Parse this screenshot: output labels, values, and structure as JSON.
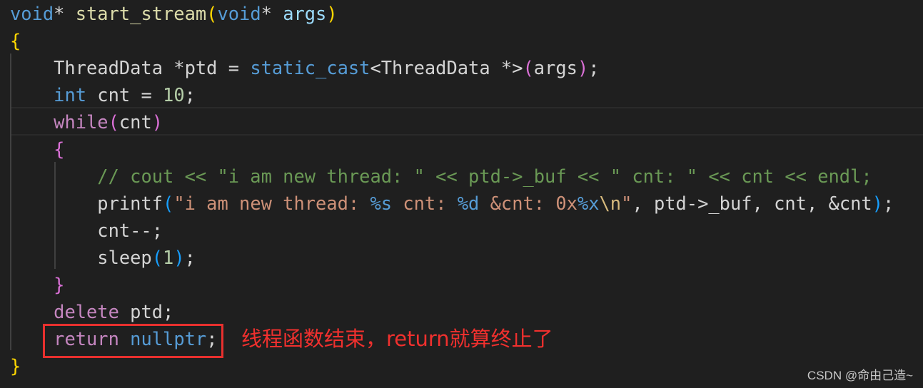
{
  "editor": {
    "background": "#1f1f1f",
    "highlighted_line": 5,
    "lines": [
      [
        [
          "void",
          "kw"
        ],
        [
          "* ",
          "txt"
        ],
        [
          "start_stream",
          "fn"
        ],
        [
          "(",
          "b1"
        ],
        [
          "void",
          "kw"
        ],
        [
          "* ",
          "txt"
        ],
        [
          "args",
          "var"
        ],
        [
          ")",
          "b1"
        ]
      ],
      [
        [
          "{",
          "b1"
        ]
      ],
      [
        [
          "    ThreadData *ptd = ",
          "txt"
        ],
        [
          "static_cast",
          "kw"
        ],
        [
          "<ThreadData *>",
          "txt"
        ],
        [
          "(",
          "b2"
        ],
        [
          "args",
          "txt"
        ],
        [
          ")",
          "b2"
        ],
        [
          ";",
          "txt"
        ]
      ],
      [
        [
          "    ",
          "txt"
        ],
        [
          "int",
          "kw"
        ],
        [
          " cnt = ",
          "txt"
        ],
        [
          "10",
          "num"
        ],
        [
          ";",
          "txt"
        ]
      ],
      [
        [
          "    ",
          "txt"
        ],
        [
          "while",
          "ctl"
        ],
        [
          "(",
          "b2"
        ],
        [
          "cnt",
          "txt"
        ],
        [
          ")",
          "b2"
        ]
      ],
      [
        [
          "    ",
          "txt"
        ],
        [
          "{",
          "b2"
        ]
      ],
      [
        [
          "        ",
          "txt"
        ],
        [
          "// cout << \"i am new thread: \" << ptd->_buf << \" cnt: \" << cnt << endl;",
          "cmt"
        ]
      ],
      [
        [
          "        printf",
          "txt"
        ],
        [
          "(",
          "b3"
        ],
        [
          "\"i am new thread: ",
          "str"
        ],
        [
          "%s",
          "kw"
        ],
        [
          " cnt: ",
          "str"
        ],
        [
          "%d",
          "kw"
        ],
        [
          " &cnt: 0x",
          "str"
        ],
        [
          "%x",
          "kw"
        ],
        [
          "\\n",
          "esc"
        ],
        [
          "\"",
          "str"
        ],
        [
          ", ptd->_buf, cnt, &cnt",
          "txt"
        ],
        [
          ")",
          "b3"
        ],
        [
          ";",
          "txt"
        ]
      ],
      [
        [
          "        cnt--;",
          "txt"
        ]
      ],
      [
        [
          "        sleep",
          "txt"
        ],
        [
          "(",
          "b3"
        ],
        [
          "1",
          "num"
        ],
        [
          ")",
          "b3"
        ],
        [
          ";",
          "txt"
        ]
      ],
      [
        [
          "    ",
          "txt"
        ],
        [
          "}",
          "b2"
        ]
      ],
      [
        [
          "    ",
          "txt"
        ],
        [
          "delete",
          "ctl"
        ],
        [
          " ptd;",
          "txt"
        ]
      ],
      [
        [
          "    ",
          "txt"
        ],
        [
          "return",
          "ctl"
        ],
        [
          " ",
          "txt"
        ],
        [
          "nullptr",
          "kw"
        ],
        [
          ";",
          "txt"
        ]
      ],
      [
        [
          "}",
          "b1"
        ]
      ]
    ]
  },
  "annotation": {
    "text": "线程函数结束，return就算终止了",
    "color": "#e8302e"
  },
  "watermark": "CSDN @命由己造~"
}
